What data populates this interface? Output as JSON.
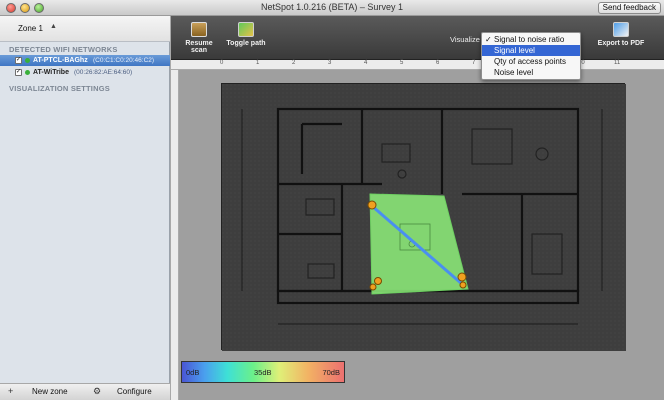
{
  "window": {
    "title": "NetSpot 1.0.216 (BETA) – Survey 1",
    "feedback_label": "Send feedback"
  },
  "sidebar": {
    "zone_label": "Zone 1",
    "detected_title": "DETECTED WIFI NETWORKS",
    "networks": [
      {
        "ssid": "AT-PTCL-BAGhz",
        "mac": "(C0:C1:C0:20:46:C2)",
        "checked": true,
        "selected": true
      },
      {
        "ssid": "AT-WiTribe",
        "mac": "(00:26:82:AE:64:60)",
        "checked": true,
        "selected": false
      }
    ],
    "visualization_title": "VISUALIZATION SETTINGS",
    "new_zone_label": "New zone",
    "configure_label": "Configure"
  },
  "toolbar": {
    "resume_label": "Resume scan",
    "toggle_label": "Toggle path",
    "visualize_label": "Visualize",
    "export_label": "Export to PDF"
  },
  "visualize_menu": {
    "checked_index": 0,
    "highlighted_index": 1,
    "items": [
      "Signal to noise ratio",
      "Signal level",
      "Qty of access points",
      "Noise level"
    ]
  },
  "ruler": {
    "ticks": [
      "0",
      "1",
      "2",
      "3",
      "4",
      "5",
      "6",
      "7",
      "8",
      "9",
      "10",
      "11"
    ]
  },
  "legend": {
    "min": "0dB",
    "mid": "35dB",
    "max": "70dB",
    "colors": [
      "#4a55d4",
      "#3ee0d6",
      "#6bf08a",
      "#dff078",
      "#ec7070"
    ]
  },
  "colors": {
    "toolbar": "#4a4a4a",
    "sidebar": "#dde3ea",
    "selection": "#3f76c4",
    "coverage": "#8ef07a",
    "path": "#4a8ff0",
    "marker": "#f0a020"
  },
  "icons": {
    "resume": "resume-scan-icon",
    "toggle": "toggle-path-icon",
    "export": "export-pdf-icon",
    "add": "plus-icon",
    "configure": "gear-icon"
  }
}
